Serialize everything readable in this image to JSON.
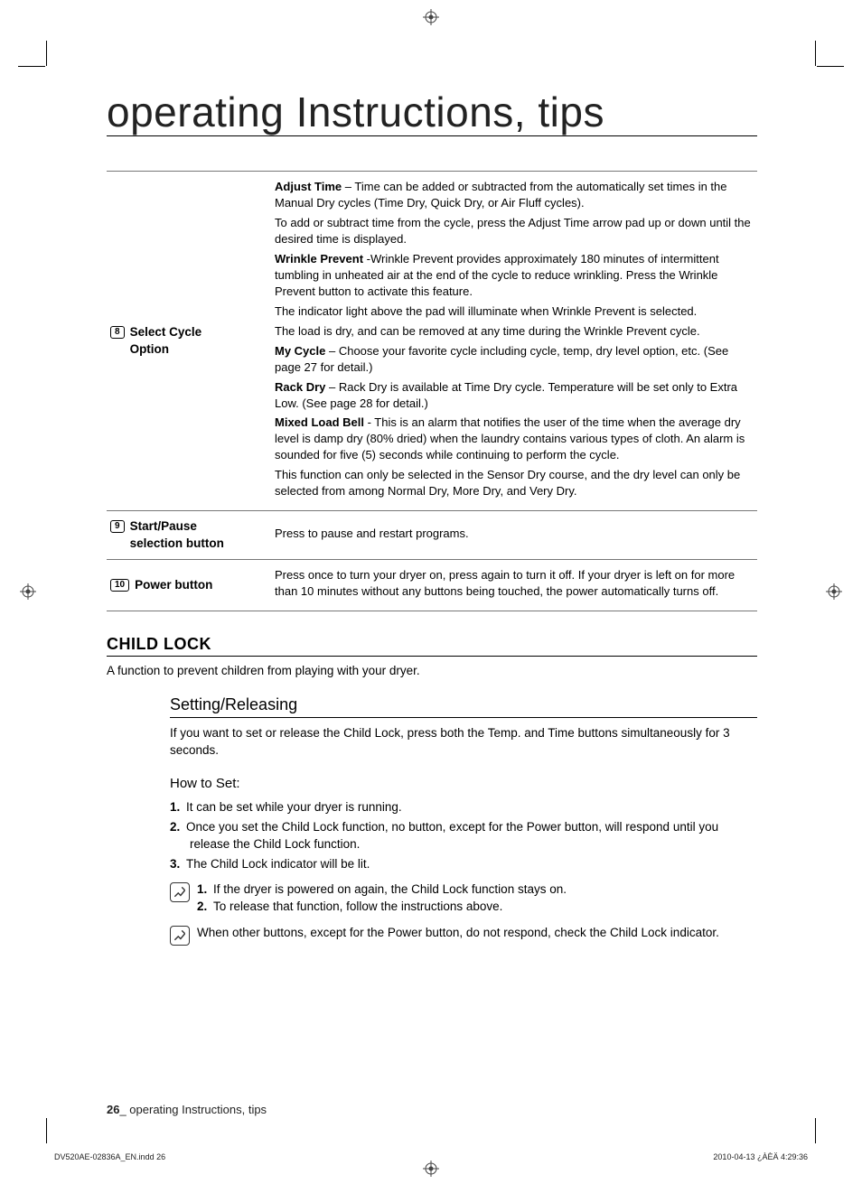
{
  "title": "operating Instructions, tips",
  "rows": [
    {
      "num": "8",
      "label": "Select Cycle Option",
      "paras": [
        {
          "lead": "Adjust Time",
          "text": " – Time can be added or subtracted from the automatically set times in the Manual Dry cycles (Time Dry, Quick Dry, or Air Fluff cycles)."
        },
        {
          "lead": "",
          "text": "To add or subtract time from the cycle, press the Adjust Time arrow pad up or down until the desired time is displayed."
        },
        {
          "lead": "Wrinkle Prevent",
          "text": " -Wrinkle Prevent provides approximately 180 minutes of intermittent tumbling in unheated air at the end of the cycle to reduce wrinkling. Press the Wrinkle Prevent button to activate this feature."
        },
        {
          "lead": "",
          "text": "The indicator light above the pad will illuminate when Wrinkle Prevent is selected."
        },
        {
          "lead": "",
          "text": "The load is dry, and can be removed at any time during the Wrinkle Prevent cycle."
        },
        {
          "lead": "My Cycle",
          "text": " – Choose your favorite cycle including cycle, temp, dry level option, etc. (See page 27 for detail.)"
        },
        {
          "lead": "Rack Dry",
          "text": " – Rack Dry is available at Time Dry cycle. Temperature will be set only to Extra Low. (See page 28 for detail.)"
        },
        {
          "lead": "Mixed Load Bell",
          "text": " - This is an alarm that notifies the user of the time when the average dry level is damp dry (80% dried) when the laundry contains various types of cloth. An alarm is sounded for five (5) seconds while continuing to perform the cycle."
        },
        {
          "lead": "",
          "text": "This function can only be selected in the Sensor Dry course, and the dry level can only be selected from among Normal Dry, More Dry, and Very Dry."
        }
      ]
    },
    {
      "num": "9",
      "label": "Start/Pause selection button",
      "paras": [
        {
          "lead": "",
          "text": "Press to pause and restart programs."
        }
      ]
    },
    {
      "num": "10",
      "label": "Power button",
      "paras": [
        {
          "lead": "",
          "text": "Press once to turn your dryer on, press again to turn it off. If your dryer is left on for more than 10 minutes without any buttons being touched, the power automatically turns off."
        }
      ]
    }
  ],
  "section": {
    "head": "CHILD LOCK",
    "text": "A function to prevent children from playing with your dryer.",
    "sub_head": "Setting/Releasing",
    "sub_text": "If you want to set or release the Child Lock, press both the Temp. and Time buttons simultaneously for 3 seconds.",
    "howto_head": "How to Set:",
    "steps": [
      "It can be set while your dryer is running.",
      "Once you set the Child Lock function, no button, except for the Power button, will respond until you release the Child Lock function.",
      "The Child Lock indicator will be lit."
    ],
    "note1": [
      "If the dryer is powered on again, the Child Lock function stays on.",
      "To release that function, follow the instructions above."
    ],
    "note2": "When other buttons, except for the Power button, do not respond, check the Child Lock indicator."
  },
  "footer": {
    "page": "26",
    "text": "_ operating Instructions, tips"
  },
  "imprint": {
    "left": "DV520AE-02836A_EN.indd   26",
    "right": "2010-04-13   ¿ÀÈÄ 4:29:36"
  }
}
